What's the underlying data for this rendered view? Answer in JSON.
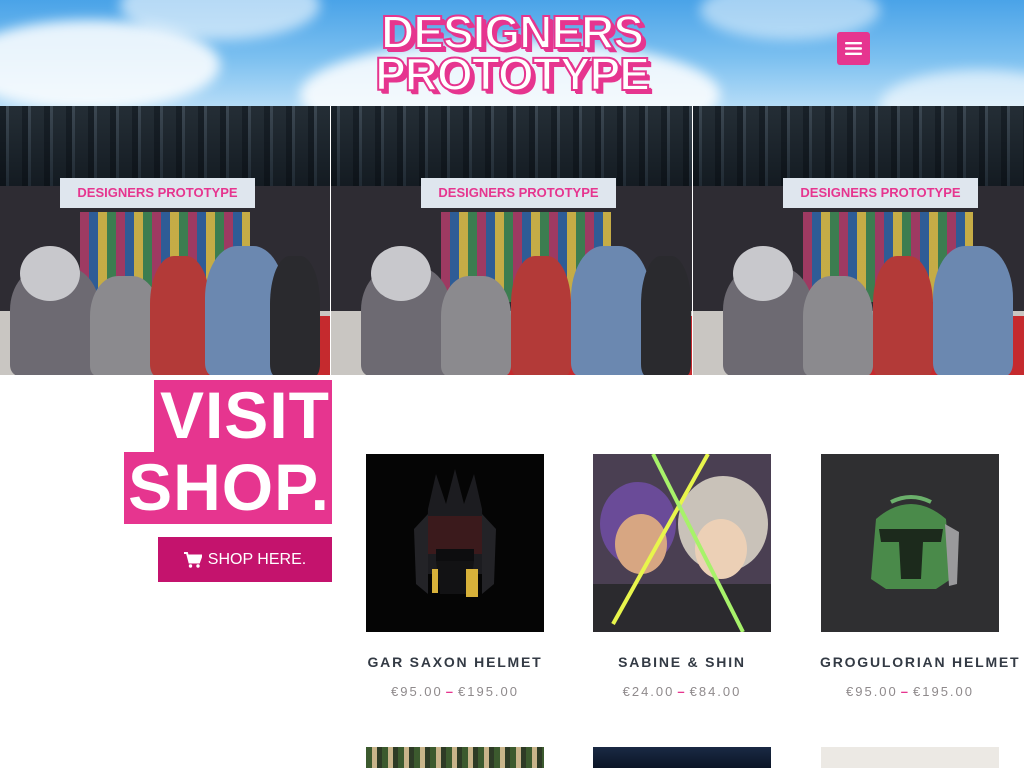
{
  "header": {
    "logo_line1": "DESIGNERS",
    "logo_line2": "PROTOTYPE",
    "menu_icon": "hamburger-menu-icon",
    "brand_color": "#e6358f"
  },
  "hero": {
    "booth_sign": "DESIGNERS PROTOTYPE"
  },
  "shop_block": {
    "title_line1": "VISIT",
    "title_line2": "SHOP.",
    "button_label": "SHOP HERE.",
    "button_icon": "shopping-cart-icon"
  },
  "products": [
    {
      "name": "GAR SAXON HELMET",
      "price_low": "€95.00",
      "price_high": "€195.00",
      "separator": "–"
    },
    {
      "name": "SABINE & SHIN",
      "price_low": "€24.00",
      "price_high": "€84.00",
      "separator": "–"
    },
    {
      "name": "GROGULORIAN HELMET",
      "price_low": "€95.00",
      "price_high": "€195.00",
      "separator": "–"
    }
  ]
}
